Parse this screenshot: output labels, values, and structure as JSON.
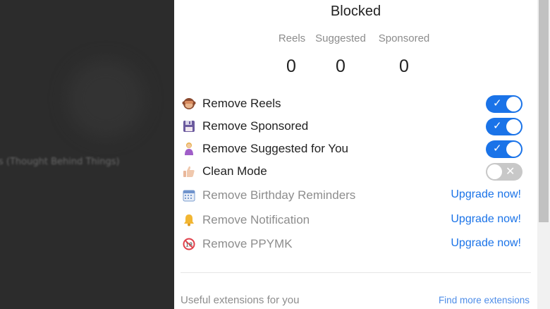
{
  "background": {
    "blurred_text": "s (Thought Behind Things)"
  },
  "panel": {
    "title": "Blocked",
    "stats": [
      {
        "label": "Reels",
        "value": "0"
      },
      {
        "label": "Suggested",
        "value": "0"
      },
      {
        "label": "Sponsored",
        "value": "0"
      }
    ],
    "toggles": [
      {
        "label": "Remove Reels",
        "icon": "see-no-evil-monkey-icon",
        "state": "on"
      },
      {
        "label": "Remove Sponsored",
        "icon": "floppy-disk-icon",
        "state": "on"
      },
      {
        "label": "Remove Suggested for You",
        "icon": "person-icon",
        "state": "on"
      },
      {
        "label": "Clean Mode",
        "icon": "thumbs-up-icon",
        "state": "off"
      }
    ],
    "premium": [
      {
        "label": "Remove Birthday Reminders",
        "icon": "calendar-icon",
        "action": "Upgrade now!"
      },
      {
        "label": "Remove Notification",
        "icon": "bell-icon",
        "action": "Upgrade now!"
      },
      {
        "label": "Remove PPYMK",
        "icon": "no-under-18-icon",
        "action": "Upgrade now!"
      }
    ],
    "footer": {
      "text": "Useful extensions for you",
      "link": "Find more extensions"
    }
  },
  "colors": {
    "accent": "#1a73e8",
    "toggle_off": "#c8c8c8",
    "muted_text": "#8d8d8d"
  }
}
